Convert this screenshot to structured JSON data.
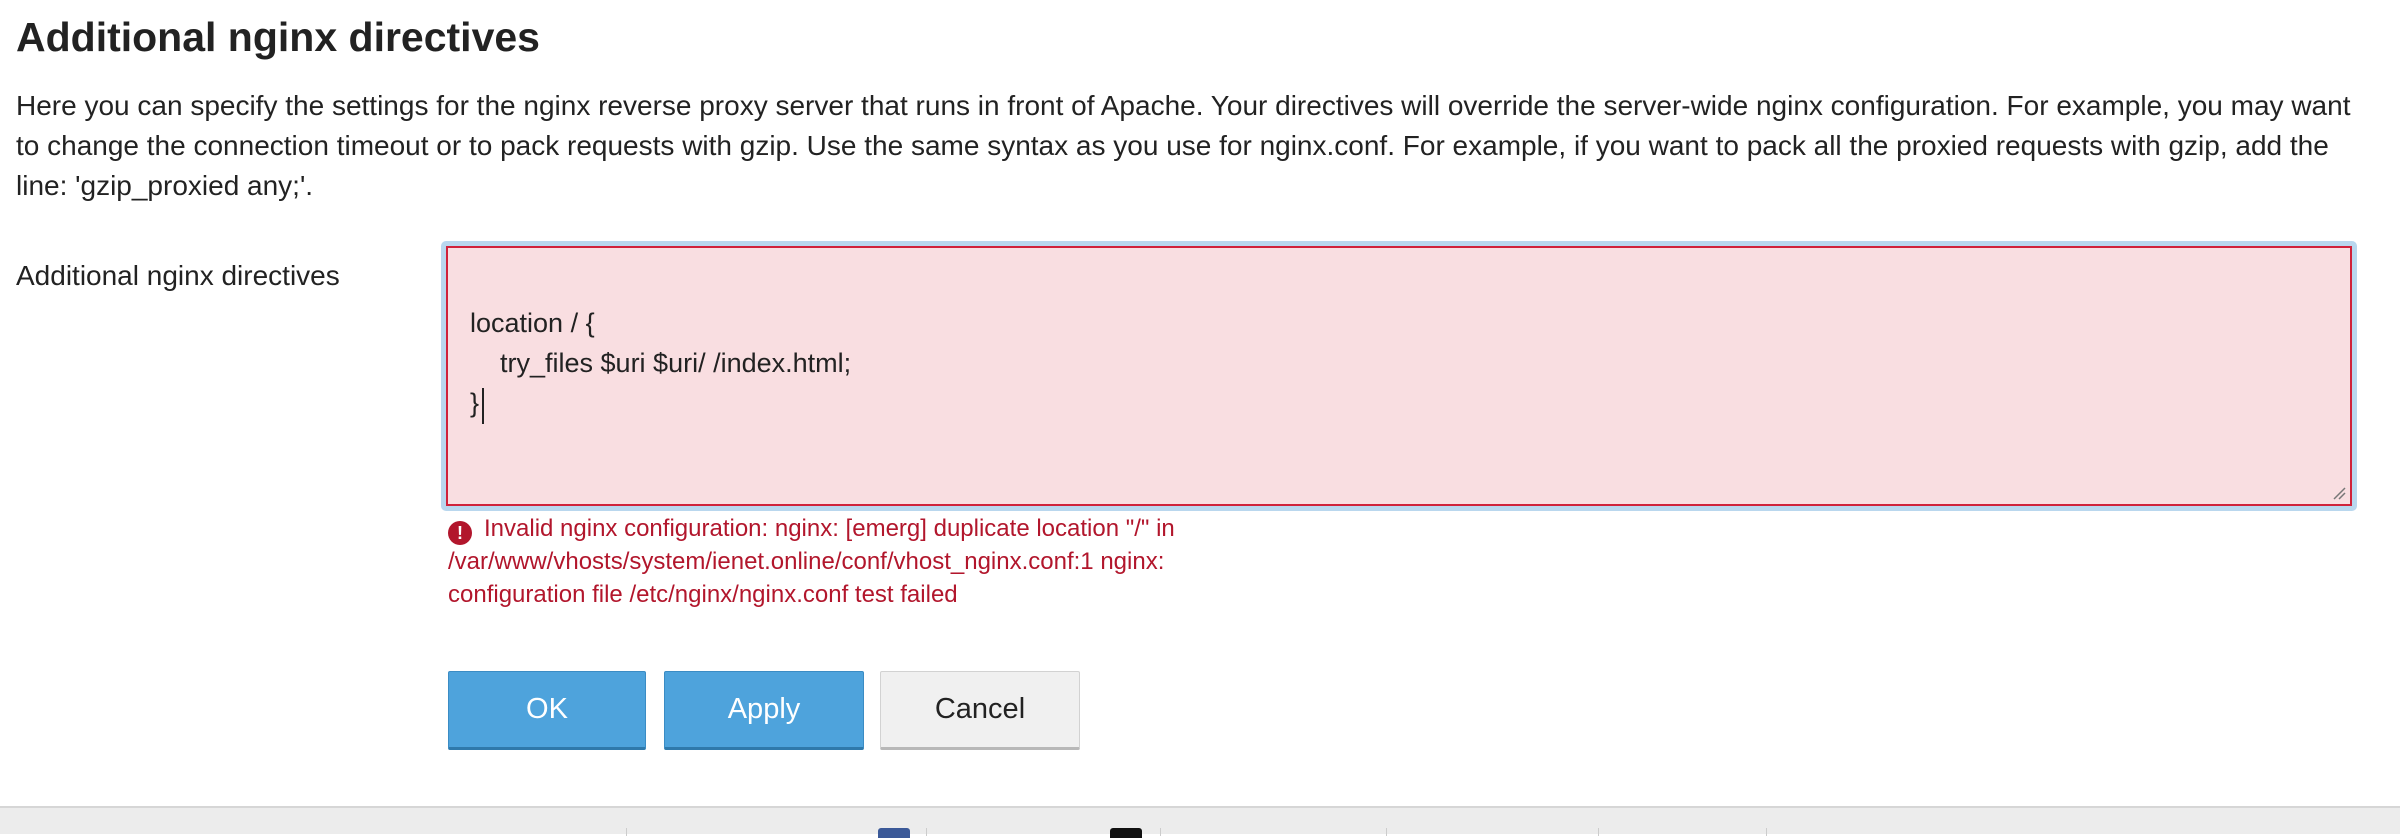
{
  "page": {
    "title": "Additional nginx directives",
    "description": "Here you can specify the settings for the nginx reverse proxy server that runs in front of Apache. Your directives will override the server-wide nginx configuration. For example, you may want to change the connection timeout or to pack requests with gzip. Use the same syntax as you use for nginx.conf. For example, if you want to pack all the proxied requests with gzip, add the line: 'gzip_proxied any;'."
  },
  "form": {
    "field_label": "Additional nginx directives",
    "textarea_lines": [
      "",
      "location / {",
      "    try_files $uri $uri/ /index.html;",
      "}"
    ],
    "error_icon": "!",
    "error_text": "Invalid nginx configuration: nginx: [emerg] duplicate location \"/\" in /var/www/vhosts/system/ienet.online/conf/vhost_nginx.conf:1 nginx: configuration file /etc/nginx/nginx.conf test failed"
  },
  "buttons": {
    "ok": "OK",
    "apply": "Apply",
    "cancel": "Cancel"
  },
  "colors": {
    "error": "#b2162c",
    "textarea_bg": "#f9dee1",
    "primary_button": "#4ea3dc",
    "focus_ring": "#b9d7ee"
  },
  "footer": {
    "icons": [
      "facebook-icon",
      "x-icon"
    ]
  }
}
